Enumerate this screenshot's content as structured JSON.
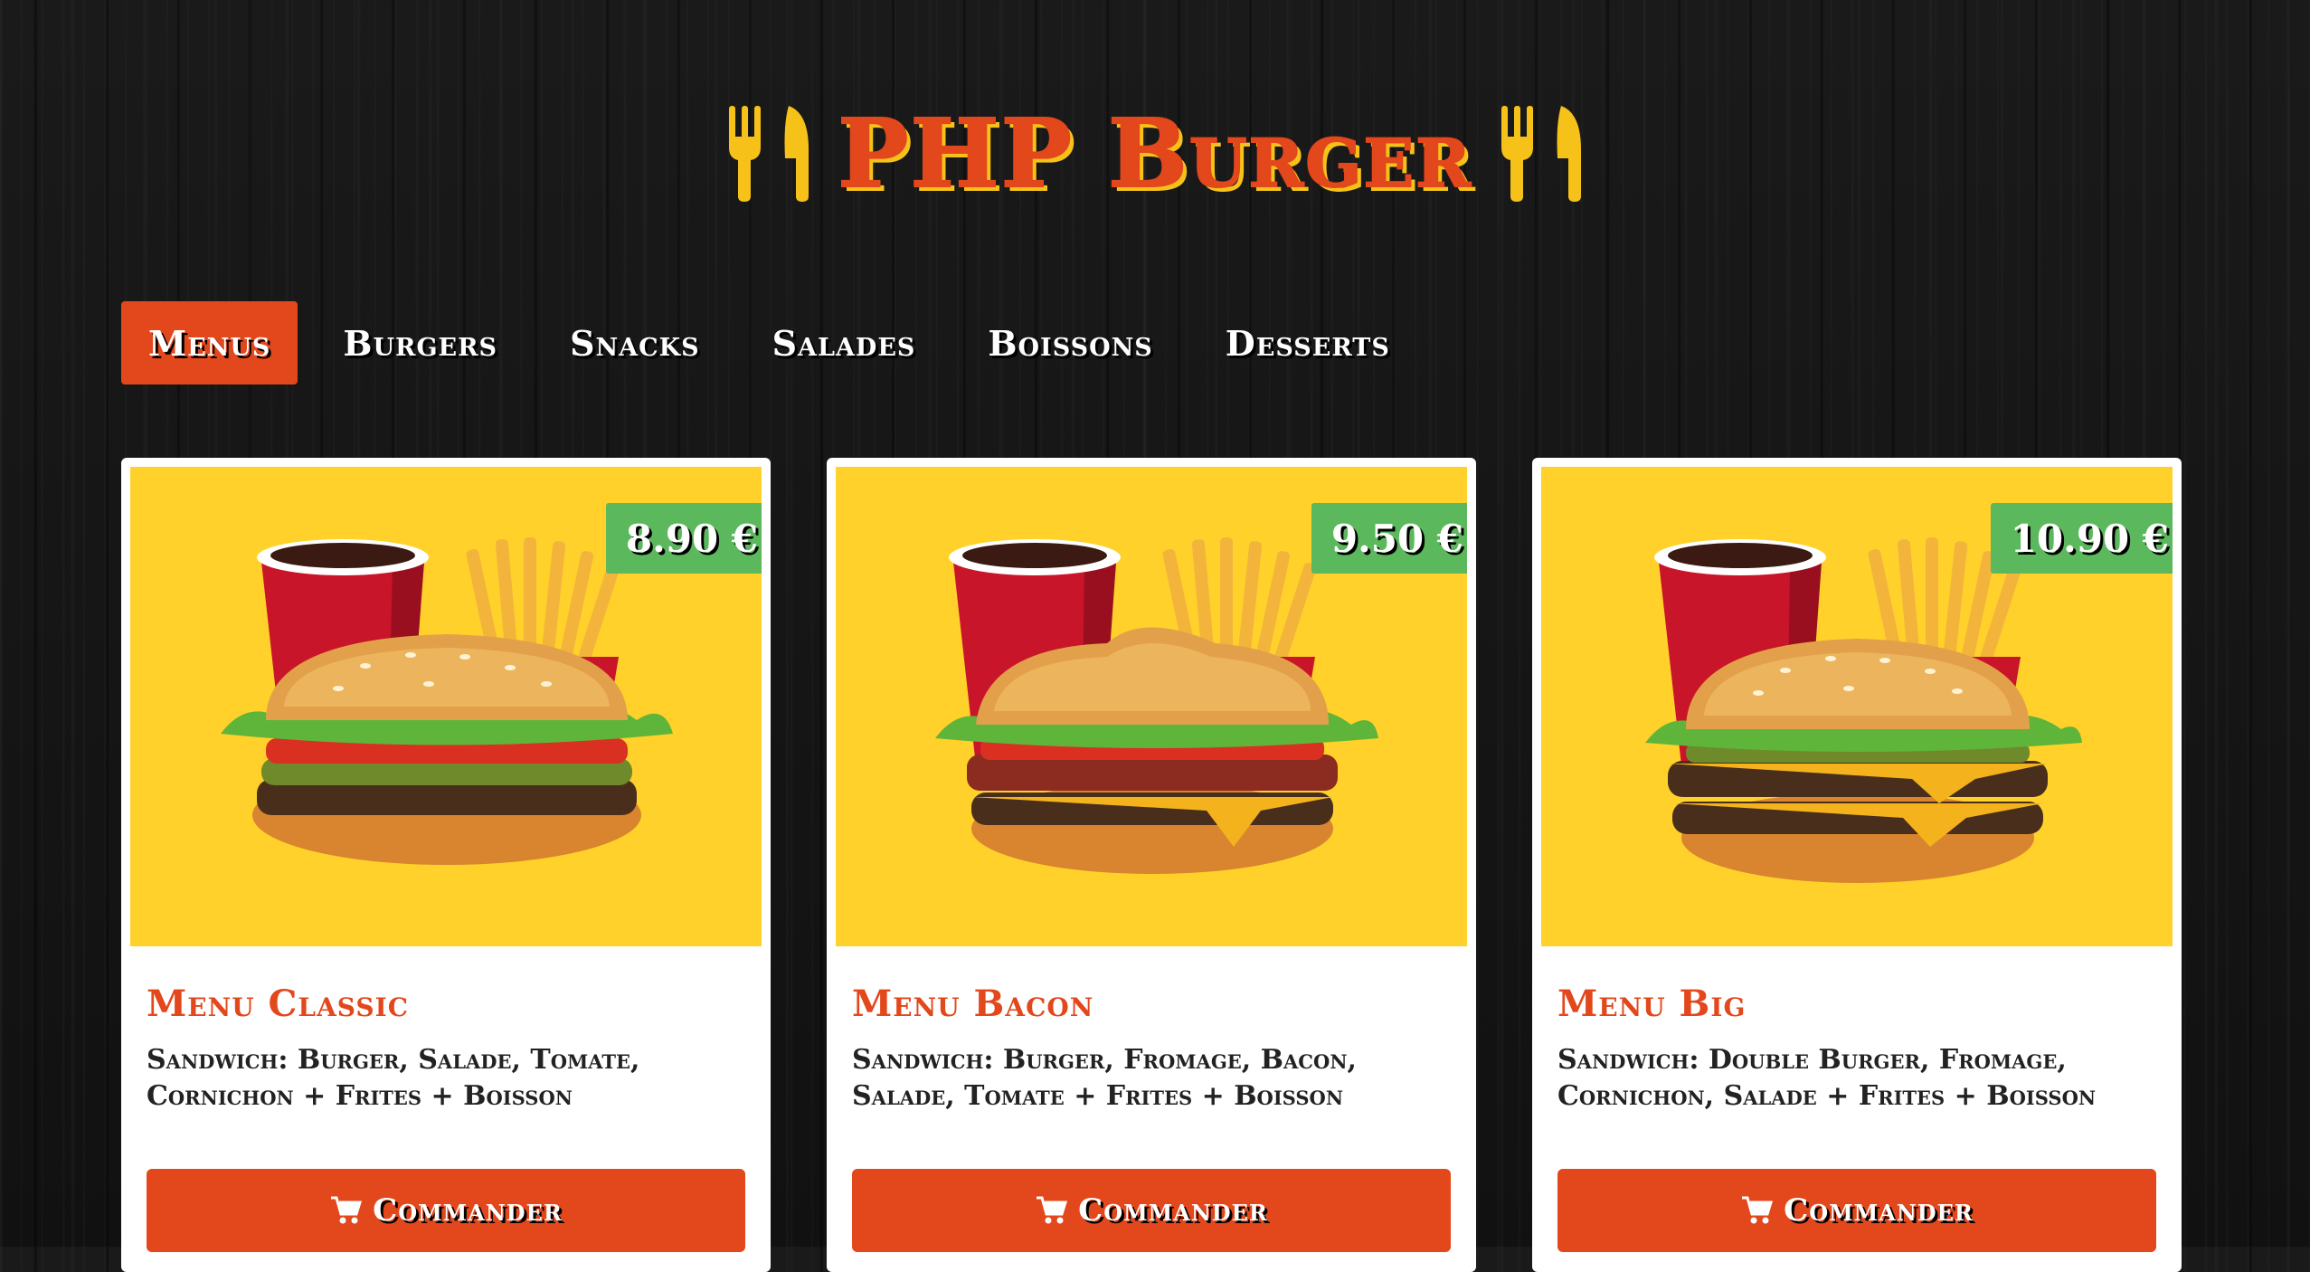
{
  "header": {
    "title": "PHP Burger",
    "icon": "fork-knife-icon"
  },
  "nav": {
    "items": [
      {
        "label": "Menus",
        "active": true
      },
      {
        "label": "Burgers",
        "active": false
      },
      {
        "label": "Snacks",
        "active": false
      },
      {
        "label": "Salades",
        "active": false
      },
      {
        "label": "Boissons",
        "active": false
      },
      {
        "label": "Desserts",
        "active": false
      }
    ]
  },
  "products": [
    {
      "name": "Menu Classic",
      "price": "8.90 €",
      "description": "Sandwich: Burger, Salade, Tomate, Cornichon + Frites + Boisson",
      "button_label": "Commander",
      "button_icon": "cart-icon"
    },
    {
      "name": "Menu Bacon",
      "price": "9.50 €",
      "description": "Sandwich: Burger, Fromage, Bacon, Salade, Tomate + Frites + Boisson",
      "button_label": "Commander",
      "button_icon": "cart-icon"
    },
    {
      "name": "Menu Big",
      "price": "10.90 €",
      "description": "Sandwich: Double Burger, Fromage, Cornichon, Salade + Frites + Boisson",
      "button_label": "Commander",
      "button_icon": "cart-icon"
    }
  ],
  "colors": {
    "brand_red": "#e3471c",
    "brand_yellow": "#ffd12a",
    "price_green": "#5cb85c",
    "background": "#141414"
  }
}
